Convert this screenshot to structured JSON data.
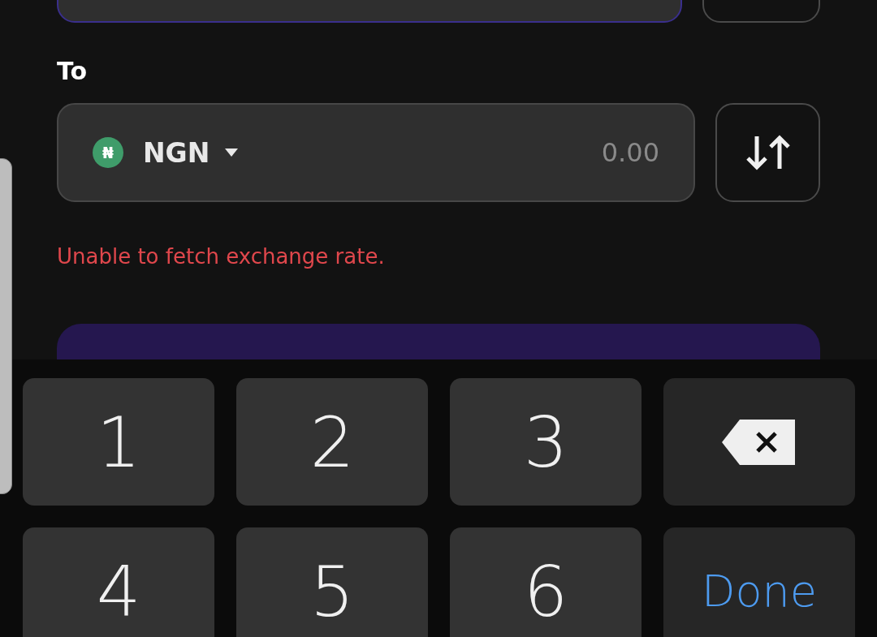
{
  "from_field": {
    "focused": true
  },
  "to": {
    "label": "To",
    "currency": {
      "symbol": "₦",
      "code": "NGN"
    },
    "placeholder": "0.00"
  },
  "error": "Unable to fetch exchange rate.",
  "keyboard": {
    "keys": [
      {
        "kind": "digit",
        "label": "1"
      },
      {
        "kind": "digit",
        "label": "2"
      },
      {
        "kind": "digit",
        "label": "3"
      },
      {
        "kind": "backspace"
      },
      {
        "kind": "digit",
        "label": "4"
      },
      {
        "kind": "digit",
        "label": "5"
      },
      {
        "kind": "digit",
        "label": "6"
      },
      {
        "kind": "done",
        "label": "Done"
      }
    ]
  }
}
